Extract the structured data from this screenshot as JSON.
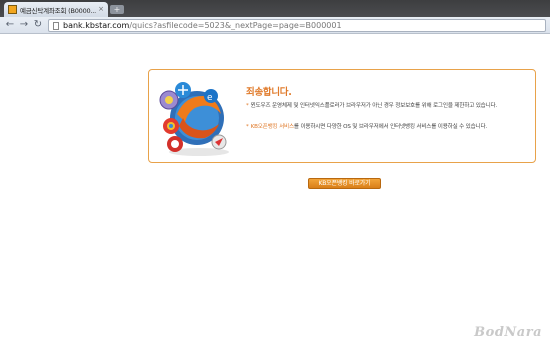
{
  "browser": {
    "tab_title": "예금신탁계좌조회 (B0000...",
    "tab_close": "×",
    "new_tab": "+",
    "back": "←",
    "forward": "→",
    "reload": "↻",
    "url_host": "bank.kbstar.com",
    "url_path": "/quics?asfilecode=5023&_nextPage=page=B000001"
  },
  "notice": {
    "title": "죄송합니다.",
    "bullet": "*",
    "line1": "윈도우즈 운영체제 및 인터넷익스플로러가 브라우저가 아닌 경우 정보보호를 위해 로그인을 제한하고 있습니다.",
    "line2_highlight": "KB오픈뱅킹 서비스",
    "line2_rest": "를 이용하시면 다양한 OS 및 브라우저에서 인터넷뱅킹 서비스를 이용하실 수 있습니다."
  },
  "button": {
    "label": "KB오픈뱅킹 바로가기"
  },
  "watermark": "BodNara",
  "colors": {
    "accent": "#e07a2a",
    "border": "#e8a24a",
    "button": "#e58e22"
  }
}
